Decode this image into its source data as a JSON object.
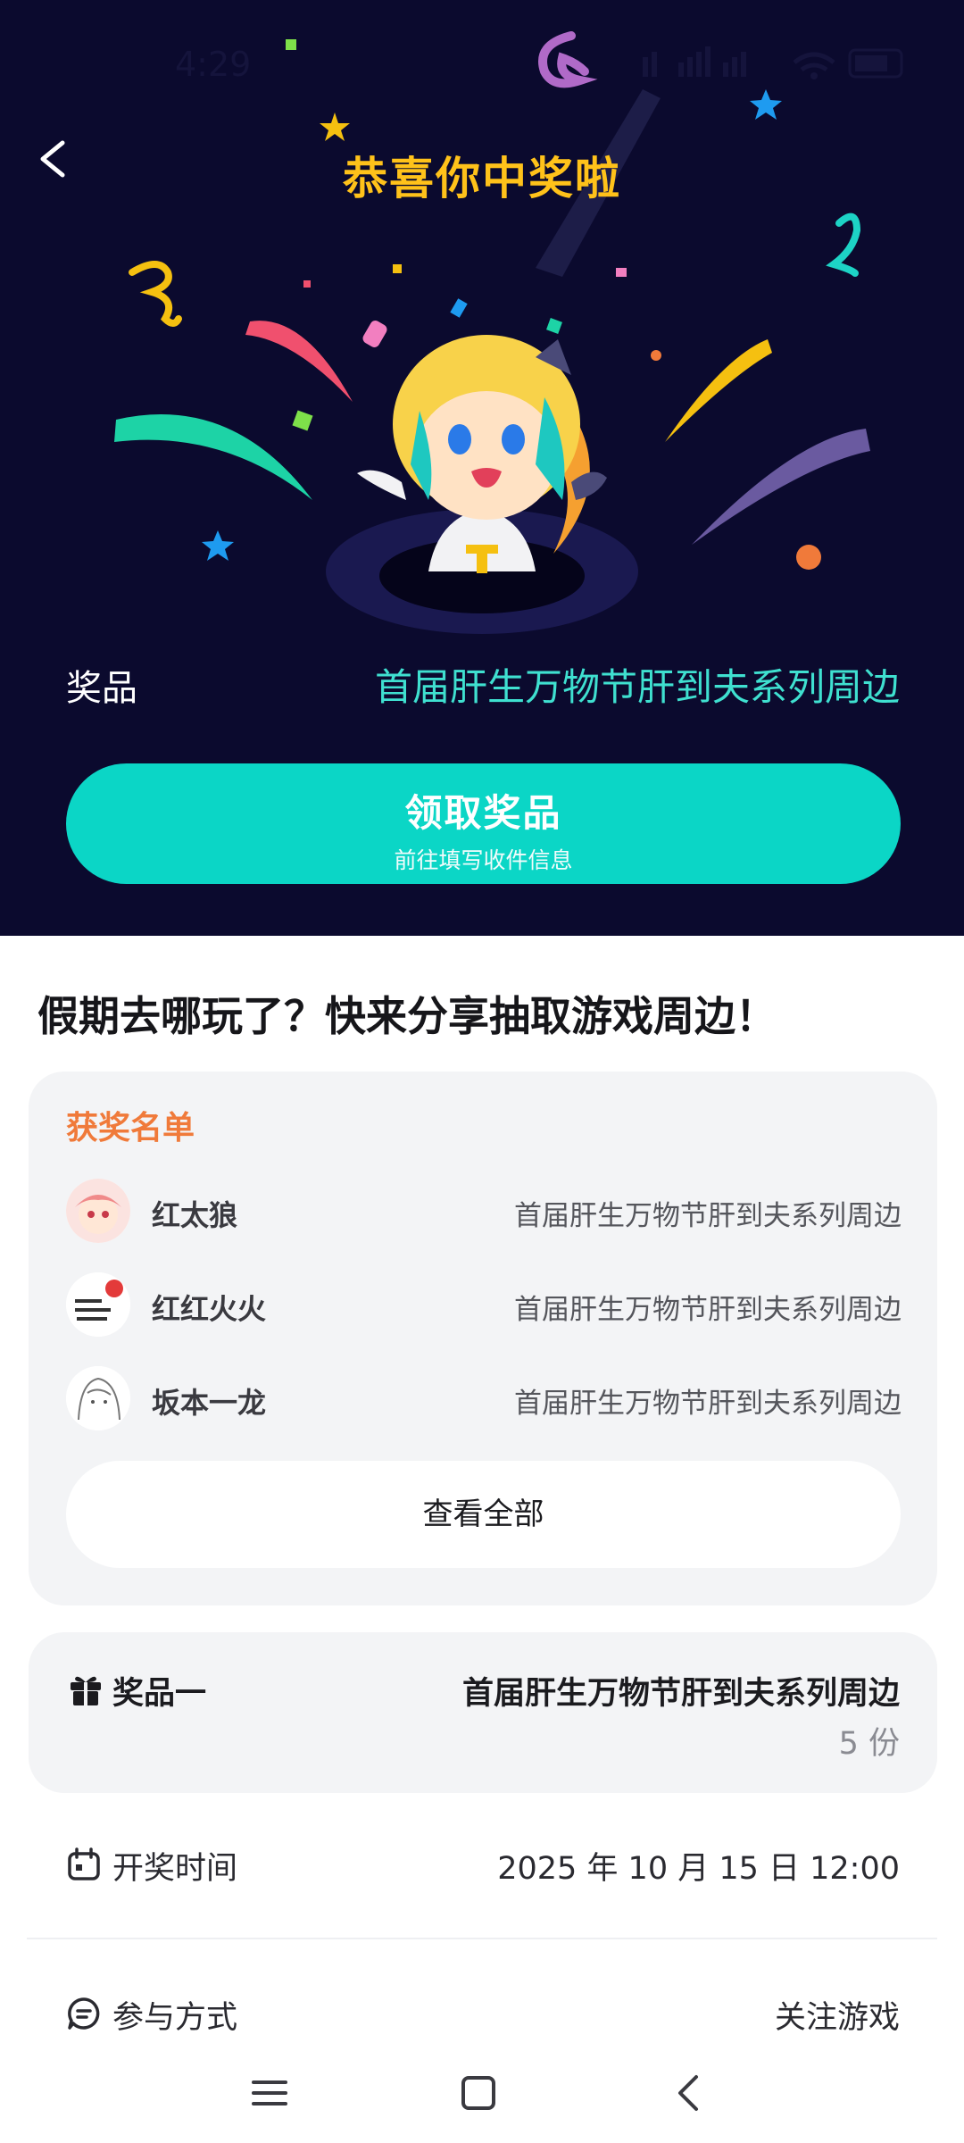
{
  "status": {
    "time": "4:29"
  },
  "hero": {
    "title": "恭喜你中奖啦",
    "prize_label": "奖品",
    "prize_value": "首届肝生万物节肝到夫系列周边",
    "claim_button": {
      "label": "领取奖品",
      "sublabel": "前往填写收件信息"
    },
    "background": "#0b0a2e",
    "title_color": "#ffc21a",
    "accent": "#0bd6c6"
  },
  "activity": {
    "title": "假期去哪玩了？快来分享抽取游戏周边！"
  },
  "winners": {
    "heading": "获奖名单",
    "items": [
      {
        "name": "红太狼",
        "prize": "首届肝生万物节肝到夫系列周边",
        "avatar": "anime-girl-avatar"
      },
      {
        "name": "红红火火",
        "prize": "首届肝生万物节肝到夫系列周边",
        "avatar": "meme-text-avatar"
      },
      {
        "name": "坂本一龙",
        "prize": "首届肝生万物节肝到夫系列周边",
        "avatar": "sketch-avatar"
      }
    ],
    "view_all": "查看全部"
  },
  "prize_card": {
    "label": "奖品一",
    "value": "首届肝生万物节肝到夫系列周边",
    "count": "5 份"
  },
  "draw_time": {
    "label": "开奖时间",
    "value": "2025 年 10 月 15 日 12:00"
  },
  "participation": {
    "label": "参与方式",
    "value": "关注游戏"
  },
  "navbar": {
    "icons": [
      "menu-icon",
      "home-square-icon",
      "back-chevron-icon"
    ]
  }
}
